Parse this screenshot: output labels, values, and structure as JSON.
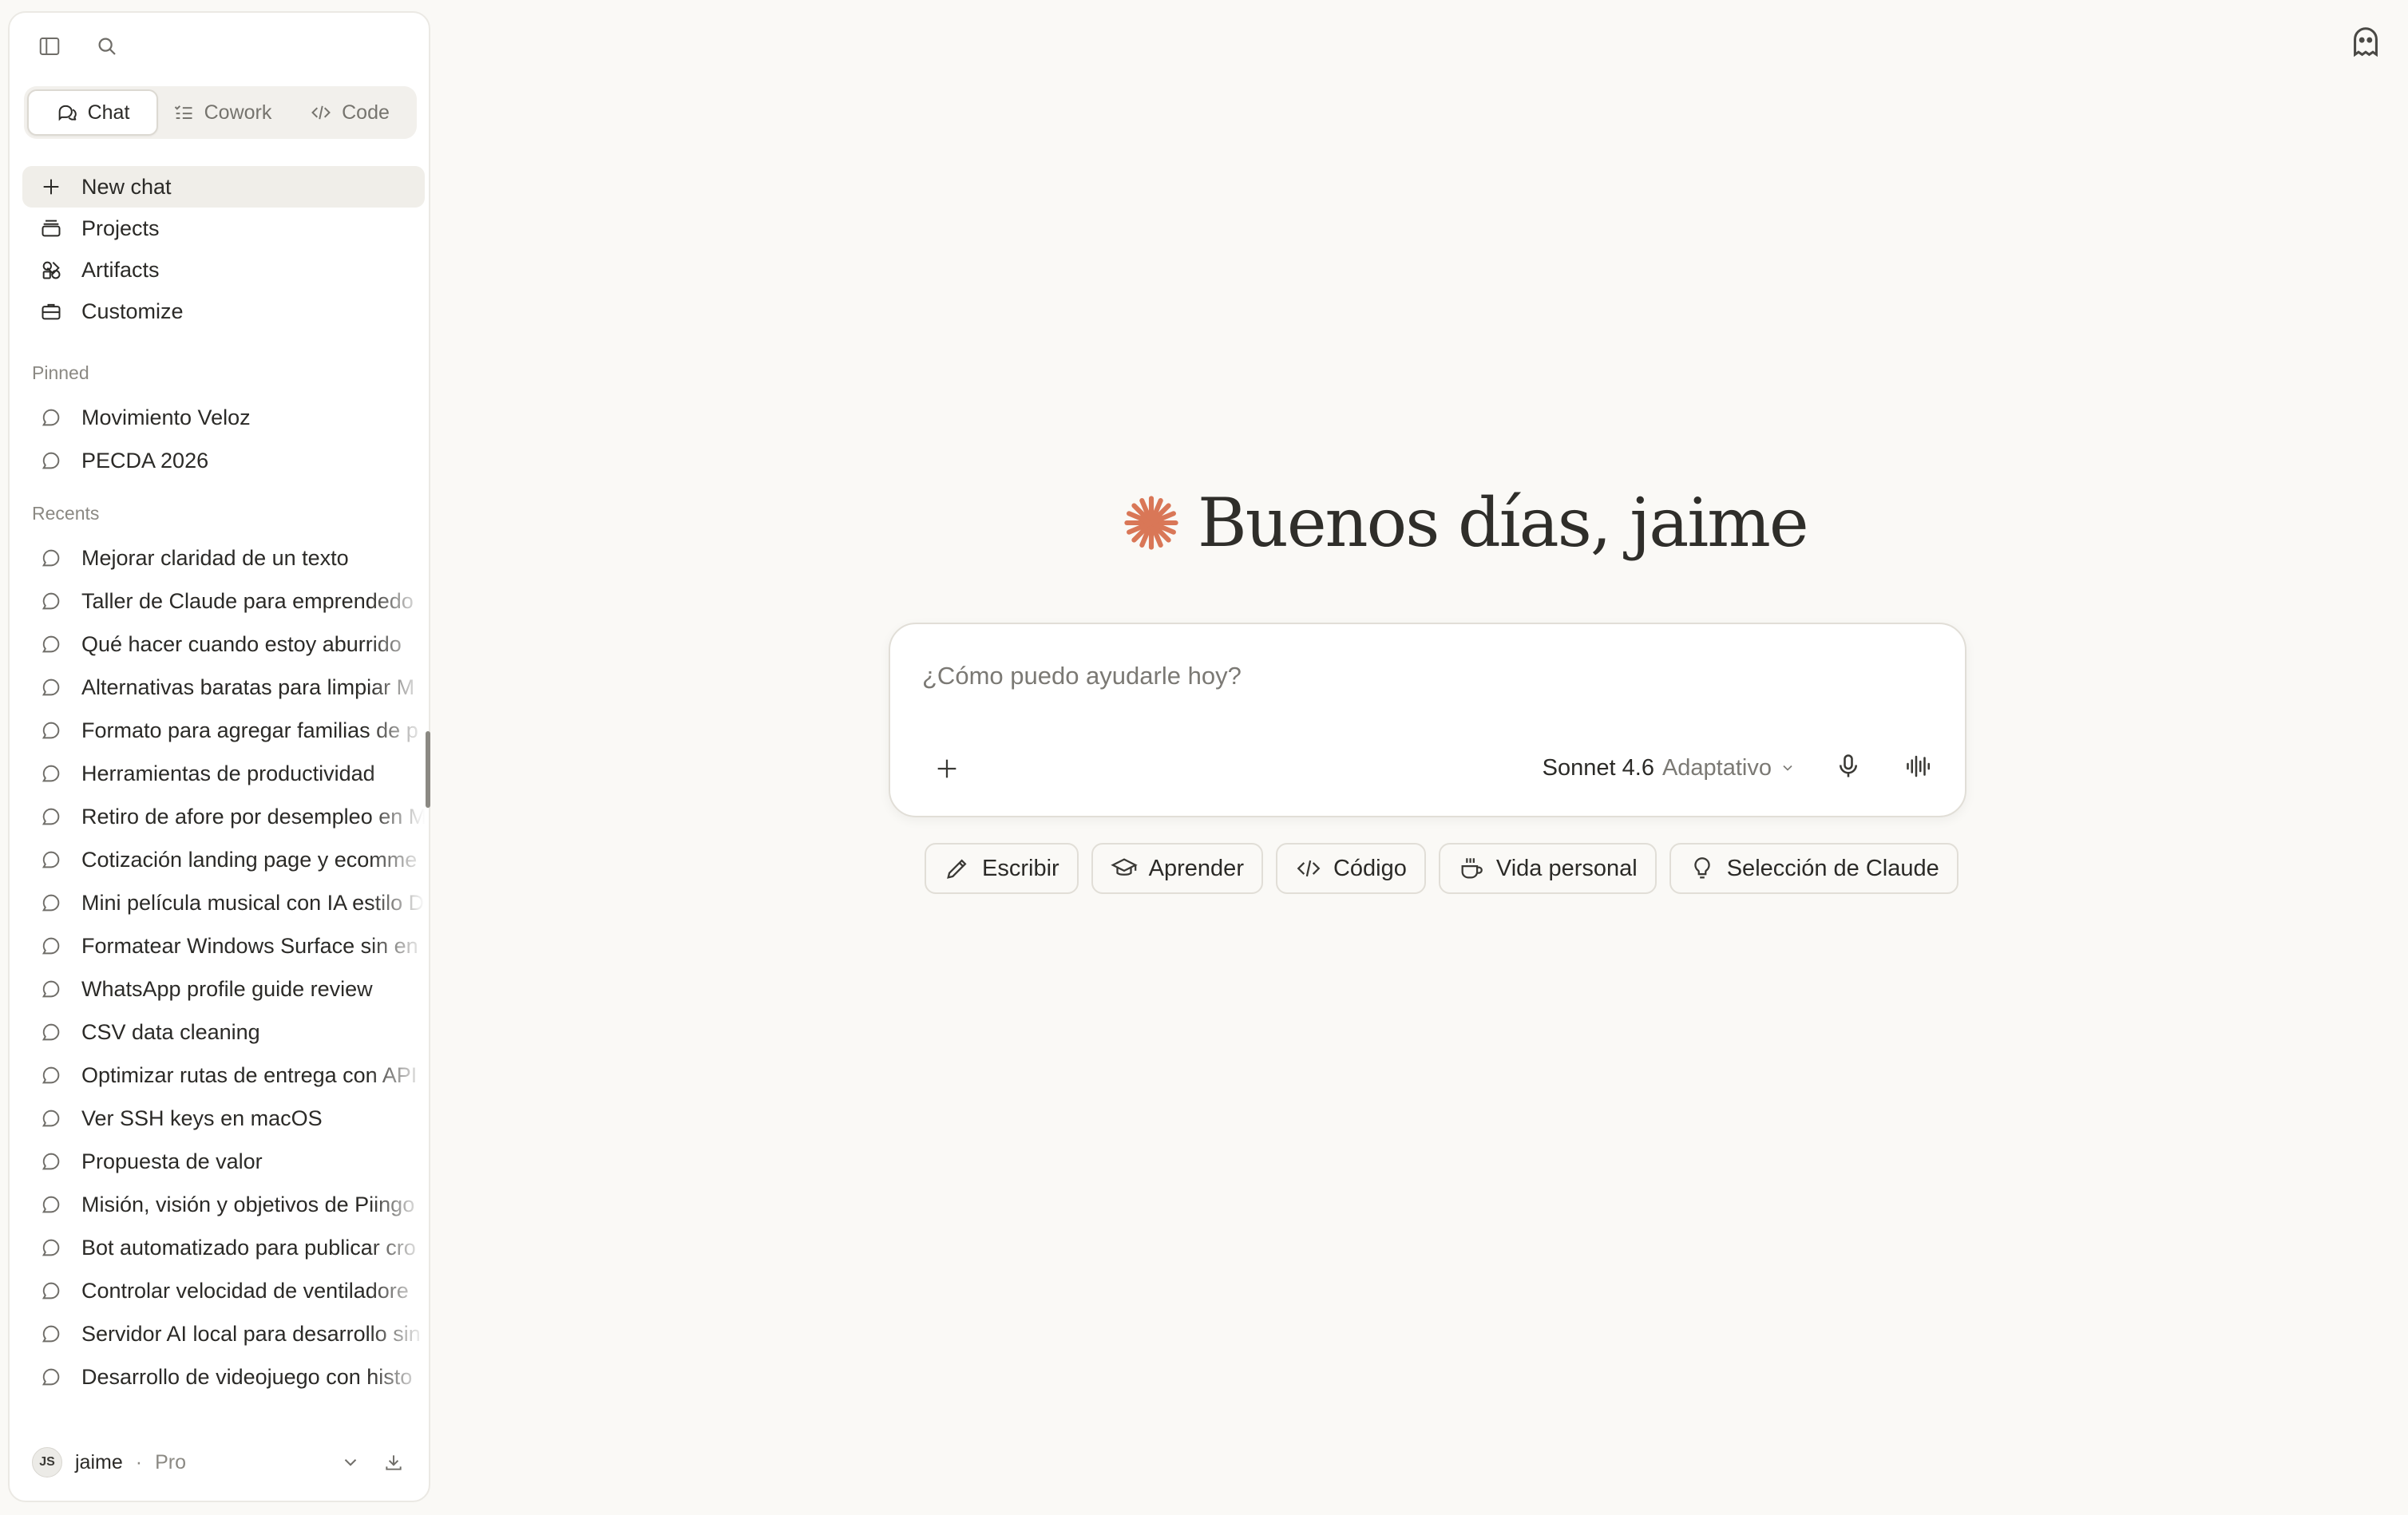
{
  "sidebar": {
    "modes": [
      {
        "label": "Chat",
        "active": true
      },
      {
        "label": "Cowork",
        "active": false
      },
      {
        "label": "Code",
        "active": false
      }
    ],
    "nav": [
      {
        "label": "New chat",
        "icon": "plus-icon"
      },
      {
        "label": "Projects",
        "icon": "projects-icon"
      },
      {
        "label": "Artifacts",
        "icon": "artifacts-icon"
      },
      {
        "label": "Customize",
        "icon": "briefcase-icon"
      }
    ],
    "pinned_label": "Pinned",
    "pinned": [
      "Movimiento Veloz",
      "PECDA 2026"
    ],
    "recents_label": "Recents",
    "recents": [
      "Mejorar claridad de un texto",
      "Taller de Claude para emprendedo",
      "Qué hacer cuando estoy aburrido",
      "Alternativas baratas para limpiar M",
      "Formato para agregar familias de p",
      "Herramientas de productividad",
      "Retiro de afore por desempleo en M",
      "Cotización landing page y ecomme",
      "Mini película musical con IA estilo D",
      "Formatear Windows Surface sin en",
      "WhatsApp profile guide review",
      "CSV data cleaning",
      "Optimizar rutas de entrega con API",
      "Ver SSH keys en macOS",
      "Propuesta de valor",
      "Misión, visión y objetivos de Piingo",
      "Bot automatizado para publicar cro",
      "Controlar velocidad de ventiladore",
      "Servidor AI local para desarrollo sin",
      "Desarrollo de videojuego con histo"
    ],
    "account": {
      "initials": "JS",
      "name": "jaime",
      "separator": "·",
      "plan": "Pro"
    }
  },
  "main": {
    "greeting": "Buenos días, jaime",
    "composer": {
      "placeholder": "¿Cómo puedo ayudarle hoy?",
      "value": ""
    },
    "model": {
      "name": "Sonnet 4.6",
      "mode": "Adaptativo"
    },
    "chips": [
      {
        "label": "Escribir",
        "icon": "pencil-icon"
      },
      {
        "label": "Aprender",
        "icon": "graduation-cap-icon"
      },
      {
        "label": "Código",
        "icon": "code-icon"
      },
      {
        "label": "Vida personal",
        "icon": "coffee-cup-icon"
      },
      {
        "label": "Selección de Claude",
        "icon": "lightbulb-icon"
      }
    ]
  },
  "colors": {
    "accent": "#d97757",
    "background": "#faf9f6",
    "sidebar": "#ffffff"
  }
}
